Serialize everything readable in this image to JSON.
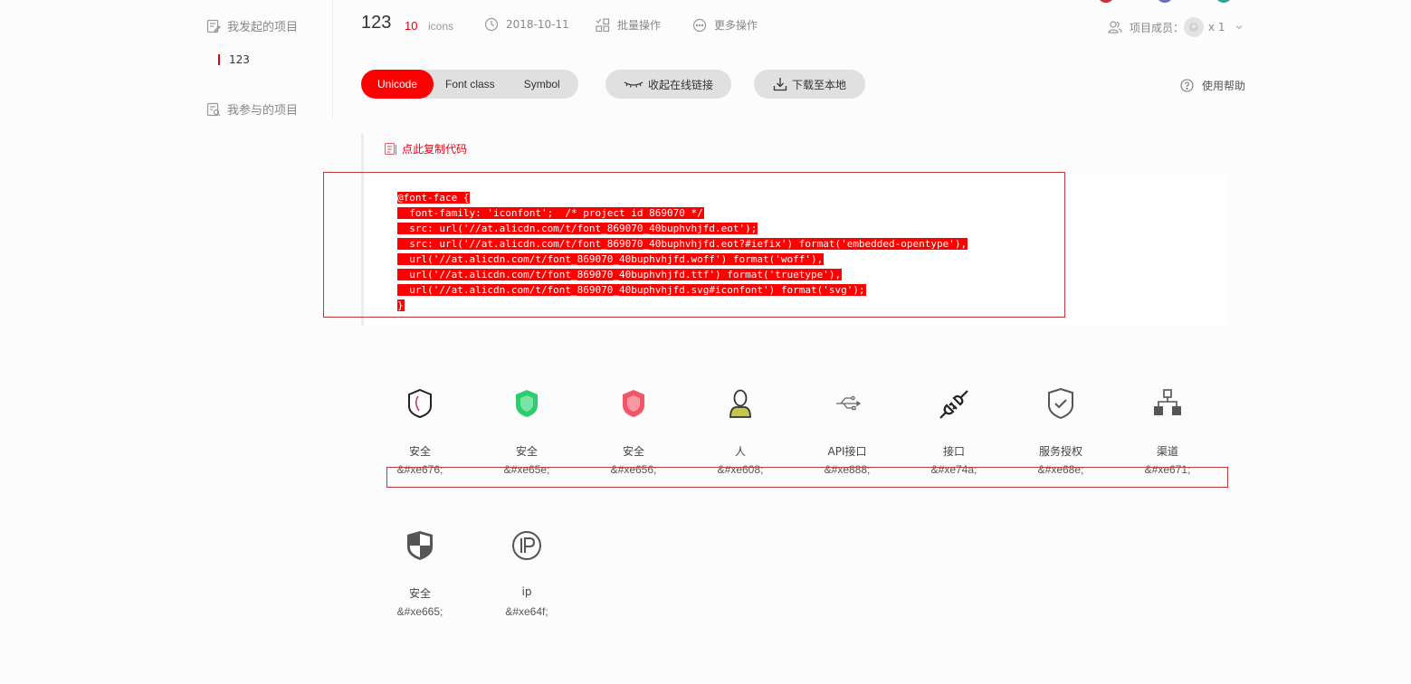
{
  "colors": {
    "accent": "#ff0000",
    "brand_red": "#e60012",
    "top_dots": [
      "#c0343b",
      "#6c6cc0",
      "#35a39a"
    ]
  },
  "sidebar": {
    "my_projects_label": "我发起的项目",
    "my_projects_items": [
      {
        "label": "123",
        "active": true
      }
    ],
    "joined_projects_label": "我参与的项目"
  },
  "header": {
    "project_title": "123",
    "icon_count": "10",
    "icon_count_unit": "icons",
    "date": "2018-10-11",
    "batch_label": "批量操作",
    "more_label": "更多操作",
    "members_label": "项目成员：",
    "members_count": "x 1"
  },
  "tabs": [
    {
      "label": "Unicode",
      "active": true
    },
    {
      "label": "Font class",
      "active": false
    },
    {
      "label": "Symbol",
      "active": false
    }
  ],
  "actions": {
    "collapse_link_label": "收起在线链接",
    "download_label": "下载至本地",
    "help_label": "使用帮助"
  },
  "code": {
    "copy_label": "点此复制代码",
    "lines": [
      "@font-face {",
      "  font-family: 'iconfont';  /* project id 869070 */",
      "  src: url('//at.alicdn.com/t/font_869070_40buphvhjfd.eot');",
      "  src: url('//at.alicdn.com/t/font_869070_40buphvhjfd.eot?#iefix') format('embedded-opentype'),",
      "  url('//at.alicdn.com/t/font_869070_40buphvhjfd.woff') format('woff'),",
      "  url('//at.alicdn.com/t/font_869070_40buphvhjfd.ttf') format('truetype'),",
      "  url('//at.alicdn.com/t/font_869070_40buphvhjfd.svg#iconfont') format('svg');",
      "}"
    ]
  },
  "icons": [
    {
      "name": "安全",
      "code": "&#xe676;",
      "glyph": "shield-outline-icon"
    },
    {
      "name": "安全",
      "code": "&#xe65e;",
      "glyph": "shield-green-icon"
    },
    {
      "name": "安全",
      "code": "&#xe656;",
      "glyph": "shield-red-icon"
    },
    {
      "name": "人",
      "code": "&#xe608;",
      "glyph": "person-icon"
    },
    {
      "name": "API接口",
      "code": "&#xe888;",
      "glyph": "usb-icon"
    },
    {
      "name": "接口",
      "code": "&#xe74a;",
      "glyph": "plug-icon"
    },
    {
      "name": "服务授权",
      "code": "&#xe68e;",
      "glyph": "shield-check-icon"
    },
    {
      "name": "渠道",
      "code": "&#xe671;",
      "glyph": "sitemap-icon"
    },
    {
      "name": "安全",
      "code": "&#xe665;",
      "glyph": "shield-quarter-icon"
    },
    {
      "name": "ip",
      "code": "&#xe64f;",
      "glyph": "ip-icon"
    }
  ]
}
